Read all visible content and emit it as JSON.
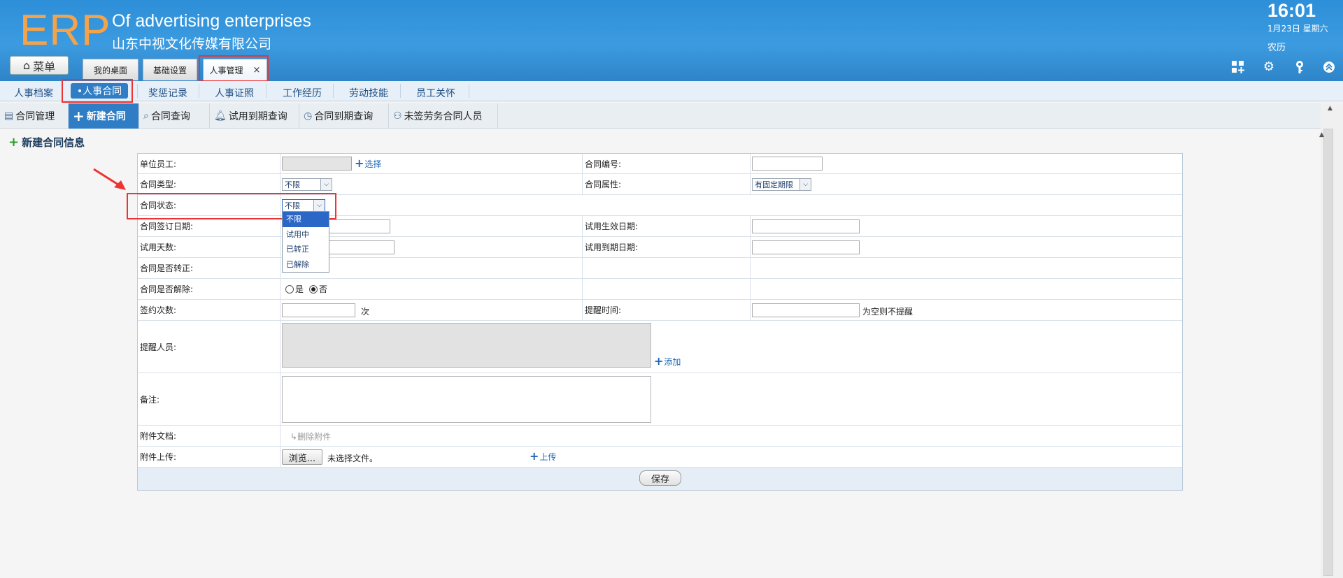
{
  "header": {
    "logo": "ERP",
    "tagline": "Of advertising enterprises",
    "company": "山东中视文化传媒有限公司",
    "time": "16:01",
    "date": "1月23日 星期六",
    "lunar": "农历",
    "colors": {
      "primary": "#2d8fd8",
      "logo": "#f5a34a",
      "highlight": "#e33333"
    }
  },
  "menu_button": {
    "label": "菜单",
    "icon": "home-icon"
  },
  "tabs": [
    {
      "label": "我的桌面"
    },
    {
      "label": "基础设置"
    },
    {
      "label": "人事管理",
      "close": "×"
    }
  ],
  "header_icons": [
    "grid-plus-icon",
    "gear-icon",
    "key-icon",
    "collapse-up-icon"
  ],
  "subnav": [
    "人事档案",
    "•人事合同",
    "奖惩记录",
    "人事证照",
    "工作经历",
    "劳动技能",
    "员工关怀"
  ],
  "toolbar": [
    {
      "label": "合同管理",
      "icon": "document-icon"
    },
    {
      "label": "新建合同",
      "icon": "plus-icon"
    },
    {
      "label": "合同查询",
      "icon": "search-icon"
    },
    {
      "label": "试用到期查询",
      "icon": "bell-icon"
    },
    {
      "label": "合同到期查询",
      "icon": "clock-icon"
    },
    {
      "label": "未签劳务合同人员",
      "icon": "user-icon"
    }
  ],
  "section_title": "新建合同信息",
  "form": {
    "employee_label": "单位员工:",
    "select_link": "选择",
    "contract_no_label": "合同编号:",
    "contract_type_label": "合同类型:",
    "contract_type_value": "不限",
    "contract_attr_label": "合同属性:",
    "contract_attr_value": "有固定期限",
    "status_label": "合同状态:",
    "status_value": "不限",
    "status_options": [
      "不限",
      "试用中",
      "已转正",
      "已解除"
    ],
    "sign_date_label": "合同签订日期:",
    "trial_start_label": "试用生效日期:",
    "trial_days_label": "试用天数:",
    "trial_end_label": "试用到期日期:",
    "converted_label": "合同是否转正:",
    "terminated_label": "合同是否解除:",
    "yes": "是",
    "no": "否",
    "sign_count_label": "签约次数:",
    "sign_count_unit": "次",
    "remind_time_label": "提醒时间:",
    "remind_note": "为空则不提醒",
    "remind_person_label": "提醒人员:",
    "add_link": "添加",
    "remark_label": "备注:",
    "attach_doc_label": "附件文档:",
    "delete_attach": "删除附件",
    "upload_label": "附件上传:",
    "browse": "浏览...",
    "no_file": "未选择文件。",
    "upload_link": "上传",
    "save": "保存"
  }
}
